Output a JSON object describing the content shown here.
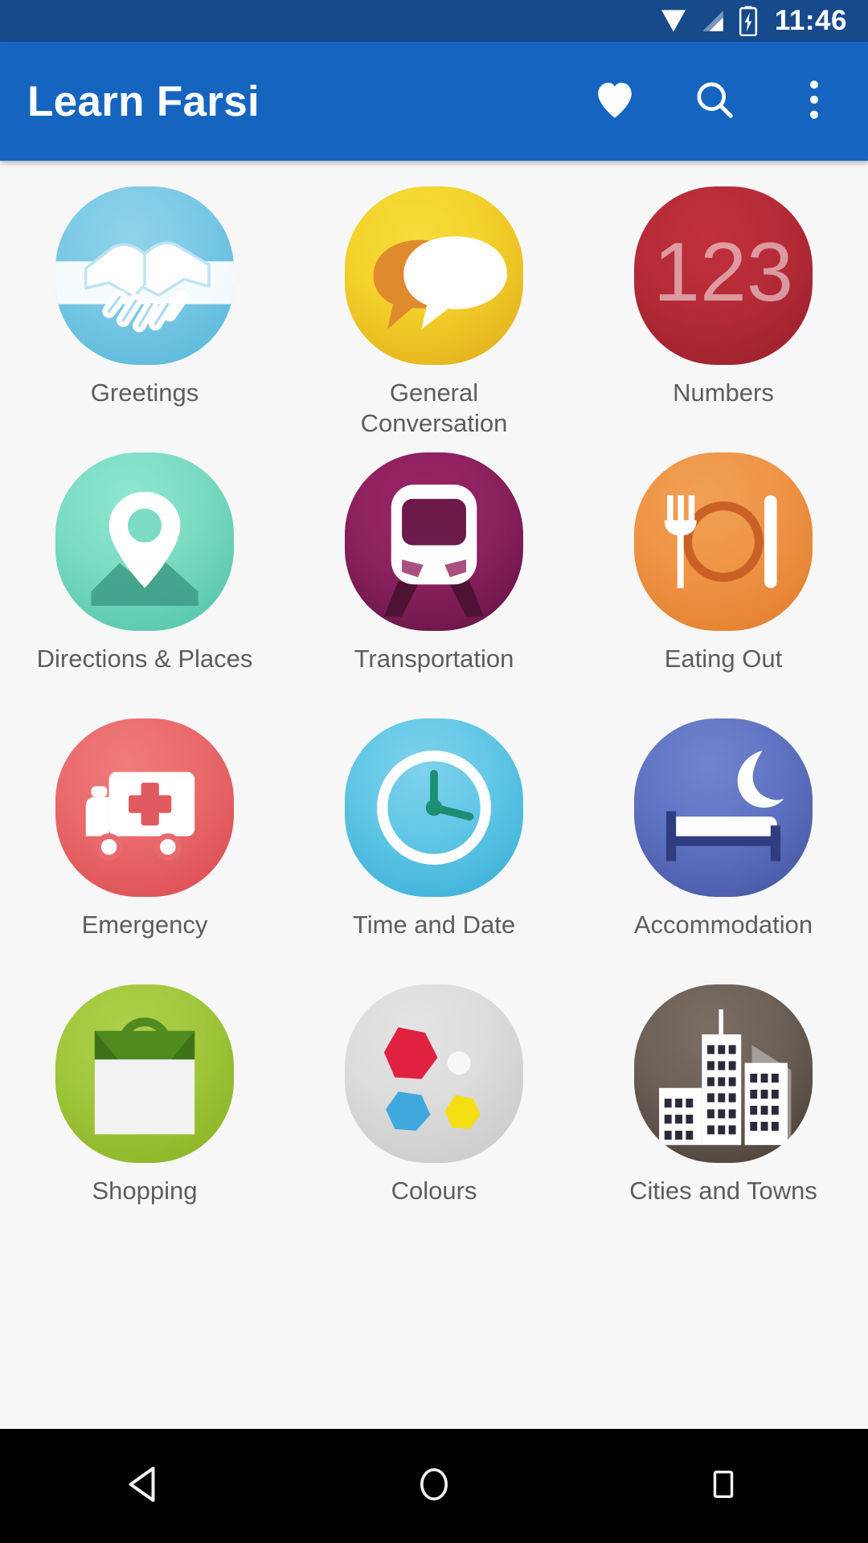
{
  "status_bar": {
    "time": "11:46",
    "icons": [
      "wifi-icon",
      "signal-icon",
      "battery-charging-icon"
    ],
    "background": "#174a8b"
  },
  "app_bar": {
    "title": "Learn Farsi",
    "background": "#1565c0",
    "actions": [
      {
        "name": "favourites-button",
        "icon": "heart-icon"
      },
      {
        "name": "search-button",
        "icon": "search-icon"
      },
      {
        "name": "overflow-menu-button",
        "icon": "more-vertical-icon"
      }
    ]
  },
  "grid": {
    "columns": 3,
    "items": [
      {
        "label": "Greetings",
        "icon": "handshake-icon",
        "color": "#7ecbe6"
      },
      {
        "label": "General Conversation",
        "icon": "speech-bubbles-icon",
        "color": "#f3d32a"
      },
      {
        "label": "Numbers",
        "icon": "one-two-three-icon",
        "color": "#b52b37"
      },
      {
        "label": "Directions & Places",
        "icon": "map-pin-icon",
        "color": "#7bdcc3"
      },
      {
        "label": "Transportation",
        "icon": "train-icon",
        "color": "#8c2160"
      },
      {
        "label": "Eating Out",
        "icon": "cutlery-plate-icon",
        "color": "#ef9546"
      },
      {
        "label": "Emergency",
        "icon": "ambulance-icon",
        "color": "#ea6a6c"
      },
      {
        "label": "Time and Date",
        "icon": "clock-icon",
        "color": "#62c7e6"
      },
      {
        "label": "Accommodation",
        "icon": "bed-moon-icon",
        "color": "#6174c4"
      },
      {
        "label": "Shopping",
        "icon": "shopping-bag-icon",
        "color": "#a2c73c"
      },
      {
        "label": "Colours",
        "icon": "colour-swatches-icon",
        "color": "#dcdcdc"
      },
      {
        "label": "Cities and Towns",
        "icon": "city-skyline-icon",
        "color": "#6d6158"
      }
    ]
  },
  "nav_bar": {
    "background": "#000000",
    "buttons": [
      {
        "name": "back-button",
        "icon": "triangle-back-icon"
      },
      {
        "name": "home-button",
        "icon": "circle-home-icon"
      },
      {
        "name": "recents-button",
        "icon": "square-recents-icon"
      }
    ]
  }
}
